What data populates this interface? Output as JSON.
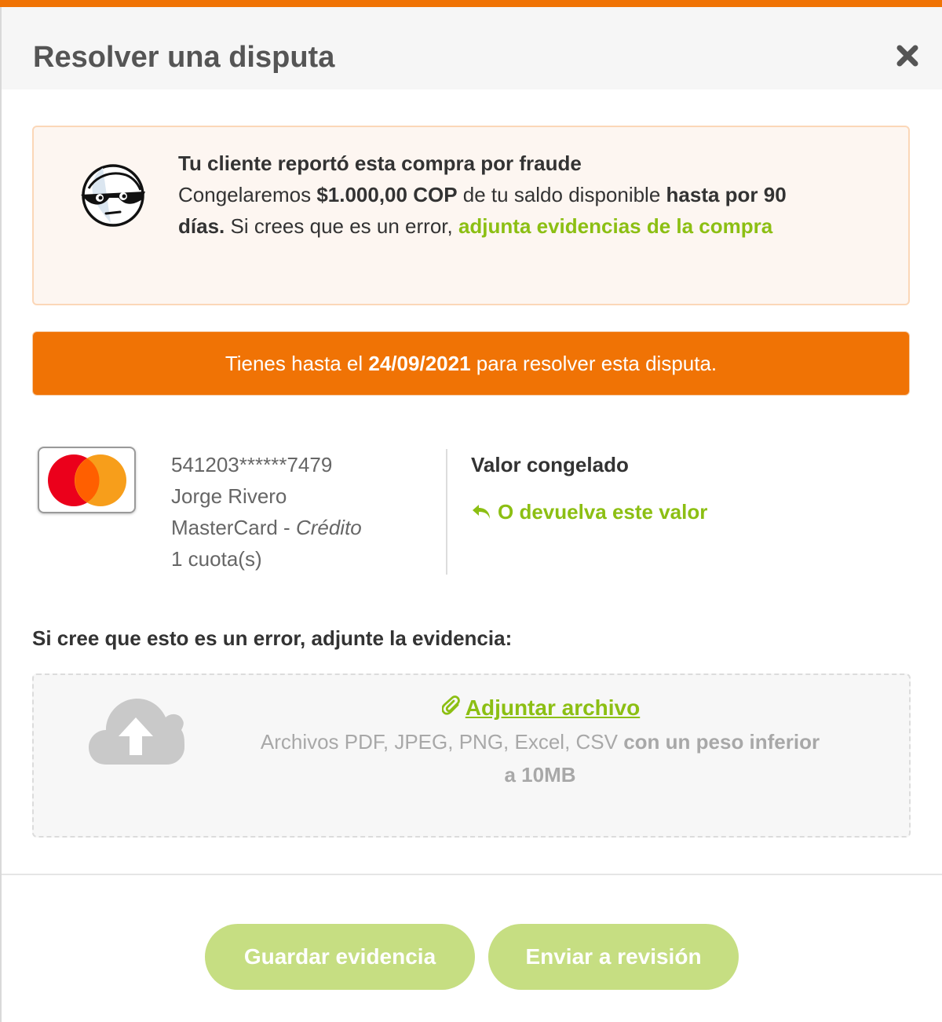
{
  "modal": {
    "title": "Resolver una disputa"
  },
  "alert": {
    "heading": "Tu cliente reportó esta compra por fraude",
    "text_1": "Congelaremos ",
    "amount": "$1.000,00 COP",
    "text_2": " de tu saldo disponible ",
    "period": "hasta por 90 días.",
    "text_3": " Si crees que es un error, ",
    "link": "adjunta evidencias de la compra"
  },
  "deadline": {
    "prefix": "Tienes hasta el ",
    "date": "24/09/2021",
    "suffix": " para resolver esta disputa."
  },
  "card": {
    "number": "541203******7479",
    "holder": "Jorge Rivero",
    "brand": "MasterCard",
    "separator": " - ",
    "type": "Crédito",
    "installments": "1 cuota(s)"
  },
  "frozen": {
    "label": "Valor congelado",
    "refund_link": "O devuelva este valor"
  },
  "evidence": {
    "label": "Si cree que esto es un error, adjunte la evidencia:",
    "attach_link": "Adjuntar archivo",
    "formats": "Archivos PDF, JPEG, PNG, Excel, CSV ",
    "limit": "con un peso inferior a 10MB"
  },
  "actions": {
    "save": "Guardar evidencia",
    "submit": "Enviar a revisión"
  },
  "colors": {
    "accent_orange": "#f07305",
    "accent_green": "#8cbf13",
    "button_green_disabled": "#c6de82"
  },
  "icons": {
    "close": "close-icon",
    "thief": "thief-icon",
    "card_brand": "mastercard-icon",
    "refund": "reply-arrow-icon",
    "attach": "paperclip-icon",
    "upload": "cloud-upload-icon"
  }
}
